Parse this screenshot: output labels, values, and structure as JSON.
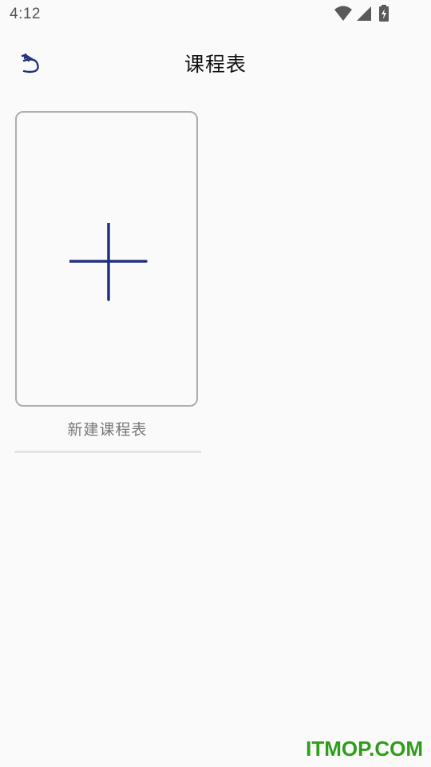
{
  "status_bar": {
    "time": "4:12",
    "icons": [
      "wifi-icon",
      "cellular-signal-icon",
      "battery-charging-icon"
    ]
  },
  "app_bar": {
    "back_icon": "back-icon",
    "title": "课程表"
  },
  "timetable_grid": {
    "new_card": {
      "icon": "plus-icon",
      "label": "新建课程表"
    }
  },
  "watermark": "ITMOP.COM",
  "colors": {
    "background": "#fafafa",
    "accent": "#23307f",
    "card_border": "#aeaeae",
    "label_text": "#777777",
    "watermark": "#2e9e1a"
  }
}
